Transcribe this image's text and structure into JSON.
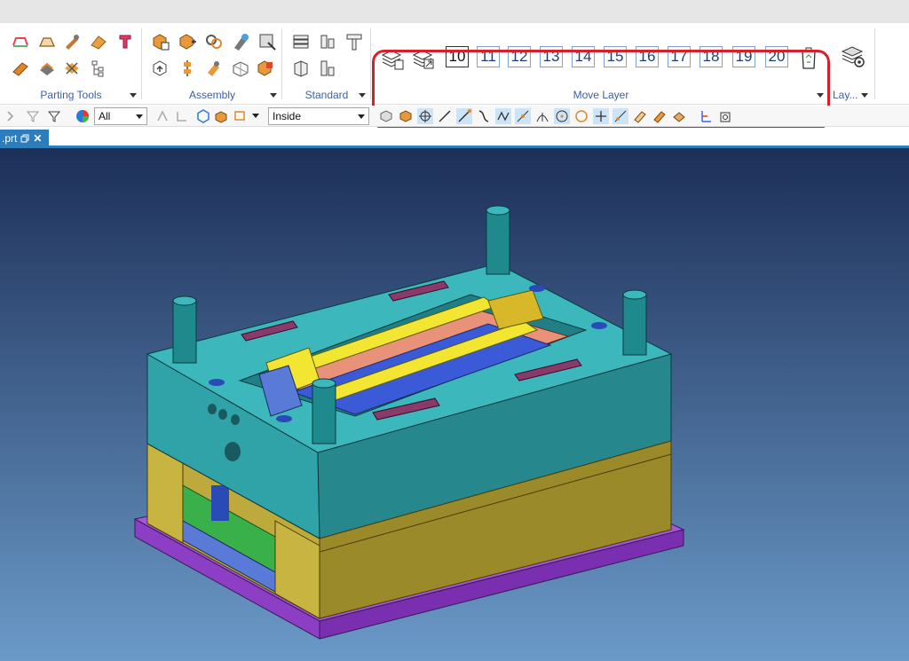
{
  "ribbon": {
    "groups": {
      "parting_tools": "Parting Tools",
      "assembly": "Assembly",
      "standard": "Standard",
      "move_layer": "Move Layer",
      "layer": "Lay..."
    },
    "layer_buttons": [
      "10",
      "11",
      "12",
      "13",
      "14",
      "15",
      "16",
      "17",
      "18",
      "19",
      "20"
    ]
  },
  "toolbar": {
    "filter_value": "All",
    "scope_value": "Inside"
  },
  "tab": {
    "label": ".prt"
  },
  "colors": {
    "highlight": "#d8202a",
    "accent": "#2d7dbc",
    "plate_teal": "#2fa3a8",
    "plate_olive": "#bda93c",
    "base_purple": "#8c3fc4",
    "slider_yellow": "#f2e632"
  }
}
